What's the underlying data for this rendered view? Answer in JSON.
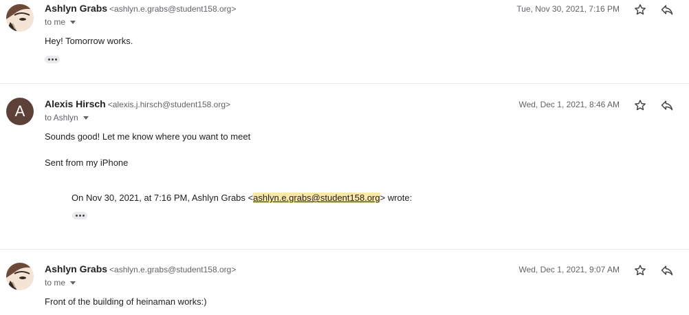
{
  "messages": [
    {
      "sender_name": "Ashlyn Grabs",
      "sender_email": "<ashlyn.e.grabs@student158.org>",
      "recipient": "to me",
      "date": "Tue, Nov 30, 2021, 7:16 PM",
      "body": [
        "Hey! Tomorrow works."
      ],
      "avatar": "photo"
    },
    {
      "sender_name": "Alexis Hirsch",
      "sender_email": "<alexis.j.hirsch@student158.org>",
      "recipient": "to Ashlyn",
      "date": "Wed, Dec 1, 2021, 8:46 AM",
      "avatar": "letter",
      "avatar_letter": "A",
      "body": [
        "Sounds good! Let me know where you want to meet",
        "Sent from my iPhone"
      ],
      "quote": {
        "prefix": "On Nov 30, 2021, at 7:16 PM, Ashlyn Grabs <",
        "link": "ashlyn.e.grabs@student158.org",
        "suffix": "> wrote:"
      }
    },
    {
      "sender_name": "Ashlyn Grabs",
      "sender_email": "<ashlyn.e.grabs@student158.org>",
      "recipient": "to me",
      "date": "Wed, Dec 1, 2021, 9:07 AM",
      "body": [
        "Front of the building of heinaman works:)"
      ],
      "avatar": "photo"
    }
  ],
  "colors": {
    "avatar_letter_bg": "#5d4037",
    "link_highlight": "#fce8a6",
    "divider": "#e8eaed"
  },
  "icons": [
    "star-icon",
    "reply-icon",
    "chevron-down-icon",
    "more-dots-icon"
  ]
}
